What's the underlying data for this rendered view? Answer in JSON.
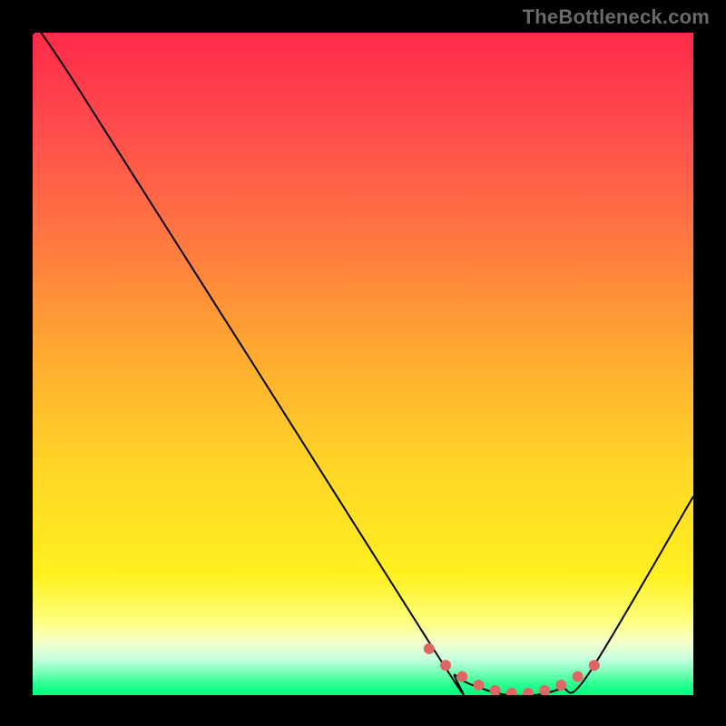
{
  "watermark": "TheBottleneck.com",
  "chart_data": {
    "type": "line",
    "title": "",
    "xlabel": "",
    "ylabel": "",
    "xlim": [
      0,
      100
    ],
    "ylim": [
      0,
      100
    ],
    "series": [
      {
        "name": "curve",
        "x": [
          0,
          6,
          60,
          64,
          68,
          72,
          76,
          80,
          84,
          100
        ],
        "y": [
          100,
          93,
          8,
          3,
          1,
          0,
          0,
          1,
          3,
          30
        ]
      }
    ],
    "markers": {
      "name": "highlight-dots",
      "x": [
        60.0,
        62.5,
        65.0,
        67.5,
        70.0,
        72.5,
        75.0,
        77.5,
        80.0,
        82.5,
        85.0
      ],
      "y": [
        7.0,
        4.5,
        2.8,
        1.5,
        0.7,
        0.3,
        0.3,
        0.7,
        1.5,
        2.8,
        4.5
      ],
      "color": "#e06666",
      "radius": 6
    },
    "background_gradient": {
      "top": "#ff2a4a",
      "mid": "#ffd427",
      "bottom": "#00ff7a"
    }
  }
}
